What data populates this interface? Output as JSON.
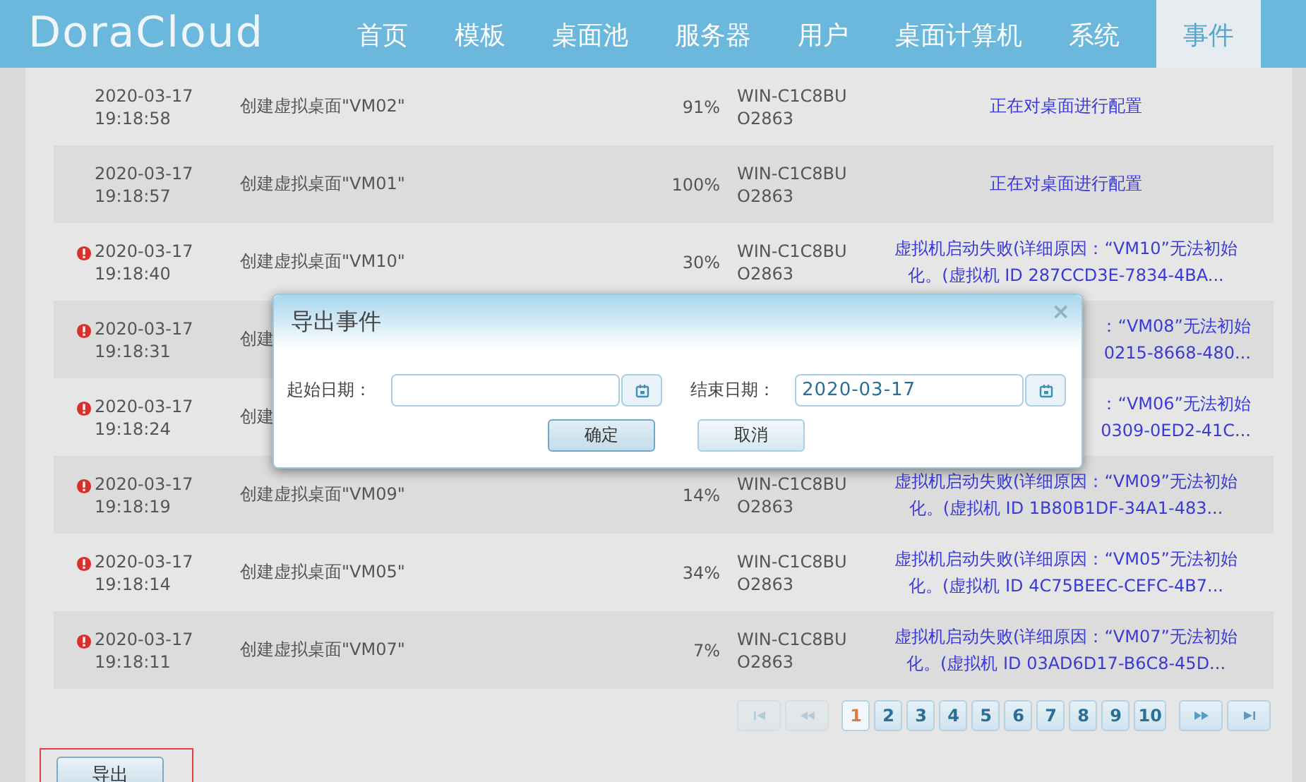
{
  "header": {
    "logo": "DoraCloud",
    "nav": [
      {
        "label": "首页",
        "selected": false
      },
      {
        "label": "模板",
        "selected": false
      },
      {
        "label": "桌面池",
        "selected": false
      },
      {
        "label": "服务器",
        "selected": false
      },
      {
        "label": "用户",
        "selected": false
      },
      {
        "label": "桌面计算机",
        "selected": false
      },
      {
        "label": "系统",
        "selected": false
      },
      {
        "label": "事件",
        "selected": true
      }
    ]
  },
  "events": [
    {
      "kind": "full",
      "error": false,
      "date": "2020-03-17",
      "time": "19:18:58",
      "name": "创建虚拟桌面\"VM02\"",
      "progress": "91%",
      "host": [
        "WIN-C1C8BU",
        "O2863"
      ],
      "message": [
        "正在对桌面进行配置"
      ]
    },
    {
      "kind": "full",
      "error": false,
      "date": "2020-03-17",
      "time": "19:18:57",
      "name": "创建虚拟桌面\"VM01\"",
      "progress": "100%",
      "host": [
        "WIN-C1C8BU",
        "O2863"
      ],
      "message": [
        "正在对桌面进行配置"
      ]
    },
    {
      "kind": "full",
      "error": true,
      "date": "2020-03-17",
      "time": "19:18:40",
      "name": "创建虚拟桌面\"VM10\"",
      "progress": "30%",
      "host": [
        "WIN-C1C8BU",
        "O2863"
      ],
      "message": [
        "虚拟机启动失败(详细原因：“VM10”无法初始",
        "化。(虚拟机 ID 287CCD3E-7834-4BA..."
      ]
    },
    {
      "kind": "partly_hidden",
      "error": true,
      "date": "2020-03-17",
      "time": "19:18:31",
      "name": "创建",
      "message": [
        "：“VM08”无法初始",
        "0215-8668-480..."
      ]
    },
    {
      "kind": "partly_hidden",
      "error": true,
      "date": "2020-03-17",
      "time": "19:18:24",
      "name": "创建",
      "message": [
        "：“VM06”无法初始",
        "0309-0ED2-41C..."
      ]
    },
    {
      "kind": "full",
      "error": true,
      "date": "2020-03-17",
      "time": "19:18:19",
      "name": "创建虚拟桌面\"VM09\"",
      "progress": "14%",
      "host": [
        "WIN-C1C8BU",
        "O2863"
      ],
      "message": [
        "虚拟机启动失败(详细原因：“VM09”无法初始",
        "化。(虚拟机 ID 1B80B1DF-34A1-483..."
      ]
    },
    {
      "kind": "full",
      "error": true,
      "date": "2020-03-17",
      "time": "19:18:14",
      "name": "创建虚拟桌面\"VM05\"",
      "progress": "34%",
      "host": [
        "WIN-C1C8BU",
        "O2863"
      ],
      "message": [
        "虚拟机启动失败(详细原因：“VM05”无法初始",
        "化。(虚拟机 ID 4C75BEEC-CEFC-4B7..."
      ]
    },
    {
      "kind": "full",
      "error": true,
      "date": "2020-03-17",
      "time": "19:18:11",
      "name": "创建虚拟桌面\"VM07\"",
      "progress": "7%",
      "host": [
        "WIN-C1C8BU",
        "O2863"
      ],
      "message": [
        "虚拟机启动失败(详细原因：“VM07”无法初始",
        "化。(虚拟机 ID 03AD6D17-B6C8-45D..."
      ]
    }
  ],
  "pagination": [
    {
      "kind": "first",
      "disabled": true
    },
    {
      "kind": "prev",
      "disabled": true
    },
    {
      "kind": "page",
      "label": "1",
      "selected": true
    },
    {
      "kind": "page",
      "label": "2",
      "selected": false
    },
    {
      "kind": "page",
      "label": "3",
      "selected": false
    },
    {
      "kind": "page",
      "label": "4",
      "selected": false
    },
    {
      "kind": "page",
      "label": "5",
      "selected": false
    },
    {
      "kind": "page",
      "label": "6",
      "selected": false
    },
    {
      "kind": "page",
      "label": "7",
      "selected": false
    },
    {
      "kind": "page",
      "label": "8",
      "selected": false
    },
    {
      "kind": "page",
      "label": "9",
      "selected": false
    },
    {
      "kind": "page",
      "label": "10",
      "selected": false
    },
    {
      "kind": "next",
      "disabled": false
    },
    {
      "kind": "last",
      "disabled": false
    }
  ],
  "export_button": {
    "label": "导出",
    "outlined": true
  },
  "dialog": {
    "title": "导出事件",
    "close": "×",
    "start_label": "起始日期：",
    "end_label": "结束日期：",
    "end_value": "2020-03-17",
    "buttons": [
      "确定",
      "取消"
    ]
  }
}
